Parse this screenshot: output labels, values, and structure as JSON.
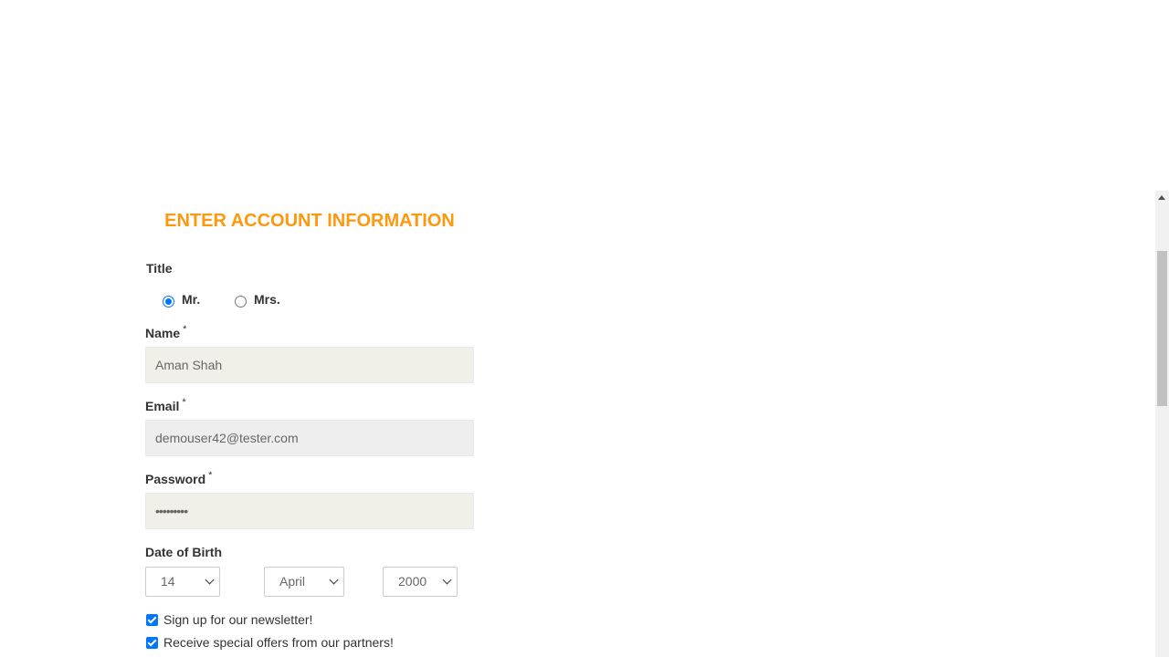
{
  "form": {
    "heading": "ENTER ACCOUNT INFORMATION",
    "title_label": "Title",
    "title_options": [
      {
        "label": "Mr.",
        "selected": true
      },
      {
        "label": "Mrs.",
        "selected": false
      }
    ],
    "name": {
      "label": "Name",
      "required_mark": "*",
      "value": "Aman Shah"
    },
    "email": {
      "label": "Email",
      "required_mark": "*",
      "value": "demouser42@tester.com"
    },
    "password": {
      "label": "Password",
      "required_mark": "*",
      "value": "•••••••••"
    },
    "dob": {
      "label": "Date of Birth",
      "day": "14",
      "month": "April",
      "year": "2000"
    },
    "newsletter": {
      "label": "Sign up for our newsletter!",
      "checked": true
    },
    "offers": {
      "label": "Receive special offers from our partners!",
      "checked": true
    }
  },
  "colors": {
    "heading": "#fe980f",
    "input_bg": "#f0f0e9",
    "accent": "#0075ff"
  }
}
